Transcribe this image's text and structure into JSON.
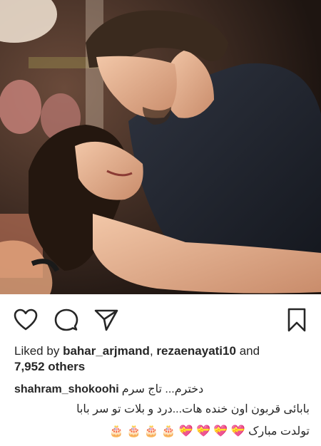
{
  "post": {
    "image_alt": "Man in a dark polo shirt embracing a smiling young girl with long dark hair, warm indoor lighting with balloons in the background",
    "likes_prefix": "Liked by",
    "liker_1": "bahar_arjmand",
    "liker_2": "rezaenayati10",
    "and_word": "and",
    "others_count": "7,952 others",
    "caption_user": "shahram_shokoohi",
    "caption_line1": "دخترم... تاج سرم",
    "caption_line2": "بابائی قربون اون خنده هات...درد و بلات تو سر بابا",
    "caption_line3_text": "تولدت مبارک",
    "caption_line3_emojis": "🎂 🎂 🎂 🎂 💝 💝 💝 💝"
  },
  "icons": {
    "like": "heart-icon",
    "comment": "comment-icon",
    "share": "send-icon",
    "save": "bookmark-icon"
  }
}
